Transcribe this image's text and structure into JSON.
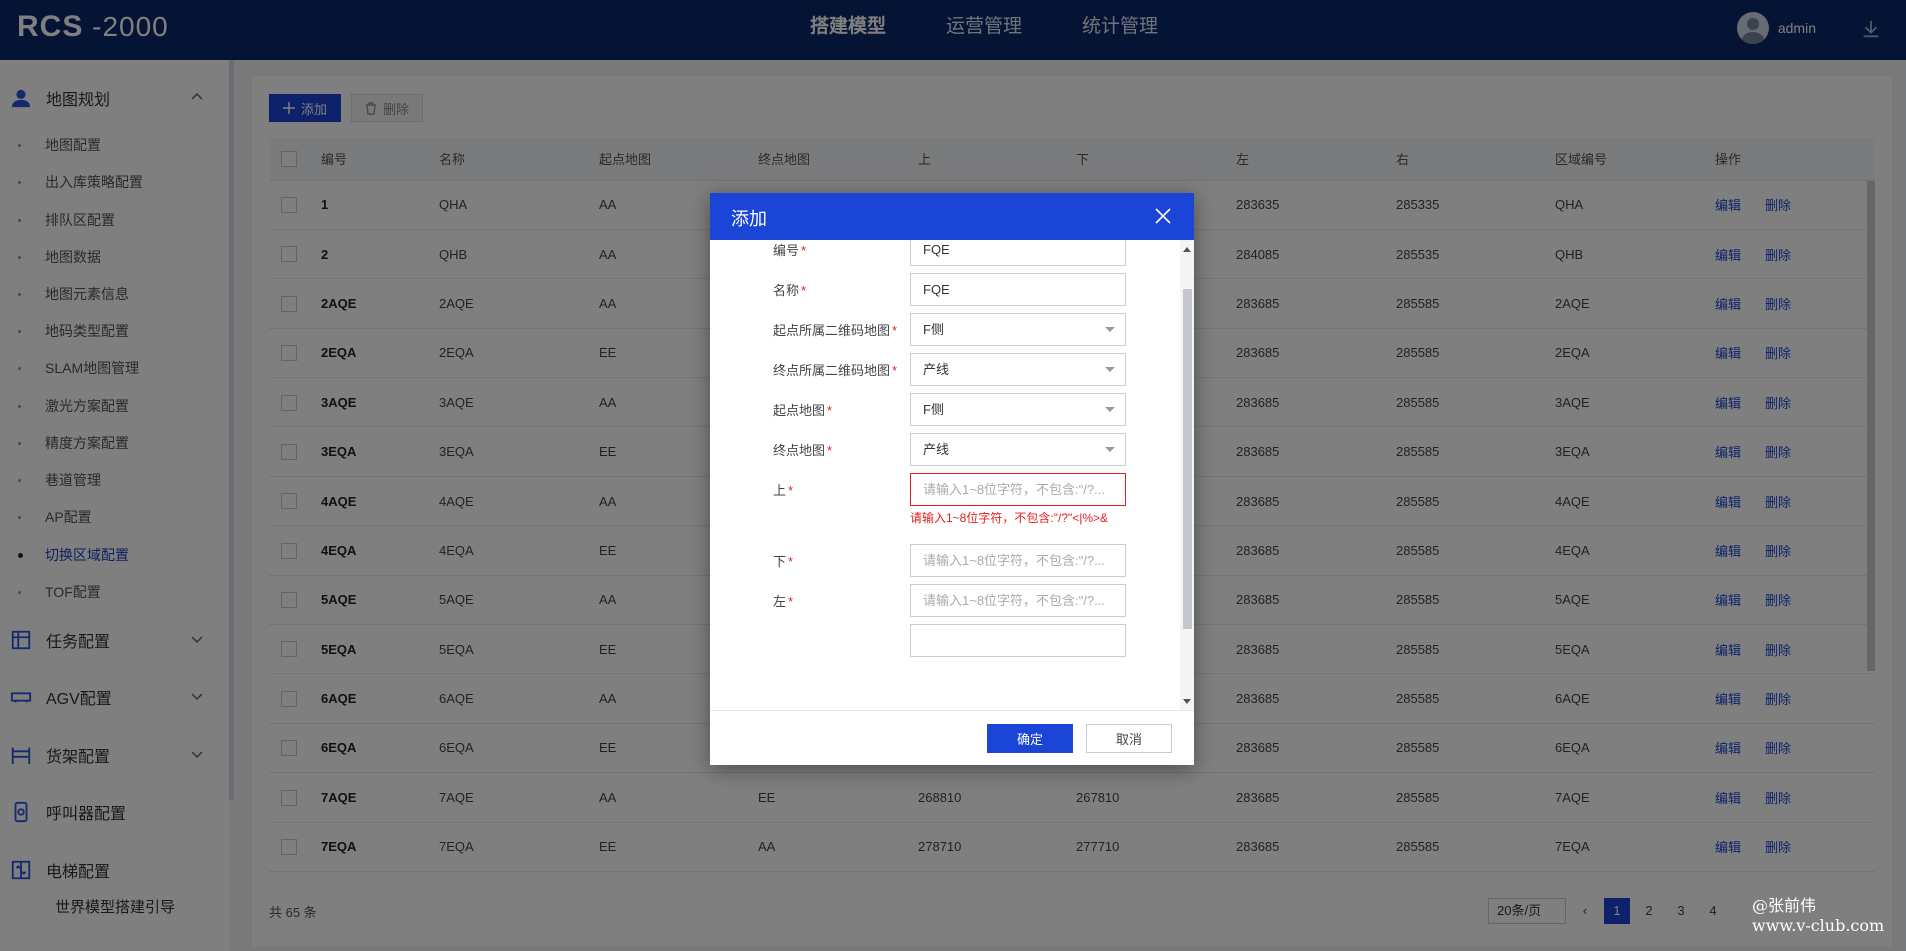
{
  "app": {
    "logo_main": "RCS",
    "logo_sub": " -2000"
  },
  "topnav": {
    "items": [
      "搭建模型",
      "运营管理",
      "统计管理"
    ],
    "active_index": 0
  },
  "user": {
    "name": "admin"
  },
  "sidebar": {
    "groups": [
      {
        "label": "地图规划",
        "icon": "map-user-icon"
      },
      {
        "label": "任务配置",
        "icon": "task-icon"
      },
      {
        "label": "AGV配置",
        "icon": "agv-icon"
      },
      {
        "label": "货架配置",
        "icon": "shelf-icon"
      },
      {
        "label": "呼叫器配置",
        "icon": "caller-icon"
      },
      {
        "label": "电梯配置",
        "icon": "elevator-icon"
      }
    ],
    "items": [
      "地图配置",
      "出入库策略配置",
      "排队区配置",
      "地图数据",
      "地图元素信息",
      "地码类型配置",
      "SLAM地图管理",
      "激光方案配置",
      "精度方案配置",
      "巷道管理",
      "AP配置",
      "切换区域配置",
      "TOF配置"
    ],
    "active_item": "切换区域配置",
    "guide": "世界模型搭建引导"
  },
  "toolbar": {
    "add_label": "添加",
    "delete_label": "删除"
  },
  "table": {
    "headers": [
      "编号",
      "名称",
      "起点地图",
      "终点地图",
      "上",
      "下",
      "左",
      "右",
      "区域编号",
      "操作"
    ],
    "rows": [
      [
        "1",
        "QHA",
        "AA",
        "",
        "",
        "",
        "283635",
        "285335",
        "QHA"
      ],
      [
        "2",
        "QHB",
        "AA",
        "",
        "",
        "",
        "284085",
        "285535",
        "QHB"
      ],
      [
        "2AQE",
        "2AQE",
        "AA",
        "",
        "",
        "",
        "283685",
        "285585",
        "2AQE"
      ],
      [
        "2EQA",
        "2EQA",
        "EE",
        "",
        "",
        "",
        "283685",
        "285585",
        "2EQA"
      ],
      [
        "3AQE",
        "3AQE",
        "AA",
        "",
        "",
        "",
        "283685",
        "285585",
        "3AQE"
      ],
      [
        "3EQA",
        "3EQA",
        "EE",
        "",
        "",
        "",
        "283685",
        "285585",
        "3EQA"
      ],
      [
        "4AQE",
        "4AQE",
        "AA",
        "",
        "",
        "",
        "283685",
        "285585",
        "4AQE"
      ],
      [
        "4EQA",
        "4EQA",
        "EE",
        "",
        "",
        "",
        "283685",
        "285585",
        "4EQA"
      ],
      [
        "5AQE",
        "5AQE",
        "AA",
        "",
        "",
        "",
        "283685",
        "285585",
        "5AQE"
      ],
      [
        "5EQA",
        "5EQA",
        "EE",
        "",
        "",
        "",
        "283685",
        "285585",
        "5EQA"
      ],
      [
        "6AQE",
        "6AQE",
        "AA",
        "",
        "",
        "",
        "283685",
        "285585",
        "6AQE"
      ],
      [
        "6EQA",
        "6EQA",
        "EE",
        "",
        "",
        "",
        "283685",
        "285585",
        "6EQA"
      ],
      [
        "7AQE",
        "7AQE",
        "AA",
        "EE",
        "268810",
        "267810",
        "283685",
        "285585",
        "7AQE"
      ],
      [
        "7EQA",
        "7EQA",
        "EE",
        "AA",
        "278710",
        "277710",
        "283685",
        "285585",
        "7EQA"
      ]
    ],
    "edit_label": "编辑",
    "delete_label": "删除"
  },
  "footer": {
    "total": "共 65 条",
    "page_size": "20条/页",
    "pages": [
      "2",
      "3",
      "4"
    ],
    "current_page": "1"
  },
  "dialog": {
    "title": "添加",
    "fields": [
      {
        "label": "编号",
        "value": "FQE",
        "type": "text"
      },
      {
        "label": "名称",
        "value": "FQE",
        "type": "text"
      },
      {
        "label": "起点所属二维码地图",
        "value": "F侧",
        "type": "select"
      },
      {
        "label": "终点所属二维码地图",
        "value": "产线",
        "type": "select"
      },
      {
        "label": "起点地图",
        "value": "F侧",
        "type": "select"
      },
      {
        "label": "终点地图",
        "value": "产线",
        "type": "select"
      },
      {
        "label": "上",
        "placeholder": "请输入1~8位字符，不包含:\"/?...",
        "type": "text",
        "error": "请输入1~8位字符，不包含:\"/?\"<|%>&"
      },
      {
        "label": "下",
        "placeholder": "请输入1~8位字符，不包含:\"/?...",
        "type": "text"
      },
      {
        "label": "左",
        "placeholder": "请输入1~8位字符，不包含:\"/?...",
        "type": "text"
      }
    ],
    "required_mark": "*",
    "ok_label": "确定",
    "cancel_label": "取消"
  },
  "watermark": {
    "line1": "@张前伟",
    "line2": "www.v-club.com"
  },
  "colors": {
    "header_bg": "#0b2768",
    "accent": "#1a45d6",
    "error": "#e02020"
  }
}
